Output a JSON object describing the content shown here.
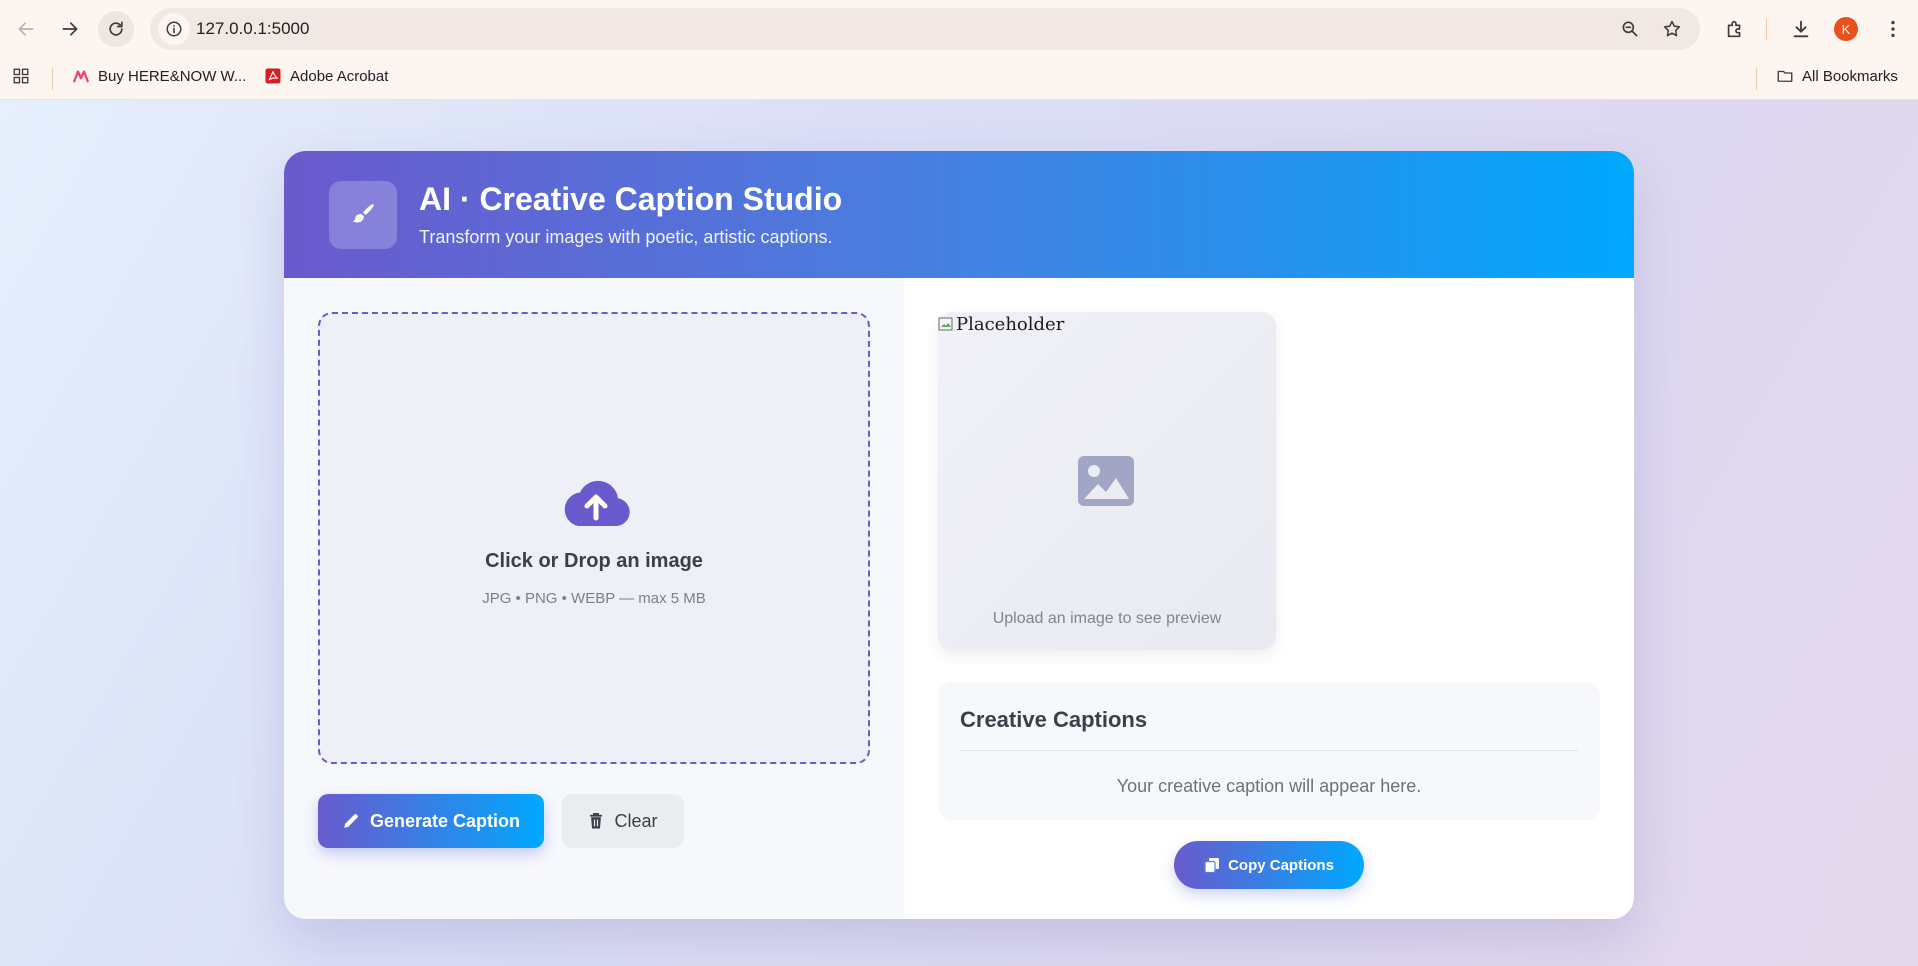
{
  "browser": {
    "url": "127.0.0.1:5000",
    "avatar_letter": "K",
    "bookmarks": [
      {
        "label": "Buy HERE&NOW W...",
        "icon": "myntra-icon"
      },
      {
        "label": "Adobe Acrobat",
        "icon": "acrobat-icon"
      }
    ],
    "all_bookmarks_label": "All Bookmarks"
  },
  "header": {
    "title": "AI · Creative Caption Studio",
    "subtitle": "Transform your images with poetic, artistic captions.",
    "logo_icon": "paintbrush-icon"
  },
  "upload": {
    "title": "Click or Drop an image",
    "hint": "JPG • PNG • WEBP — max 5 MB",
    "icon": "cloud-upload-icon"
  },
  "buttons": {
    "generate": "Generate Caption",
    "clear": "Clear",
    "copy": "Copy Captions"
  },
  "preview": {
    "alt_text": "Placeholder",
    "hint": "Upload an image to see preview",
    "icon": "image-icon"
  },
  "captions": {
    "title": "Creative Captions",
    "placeholder": "Your creative caption will appear here."
  },
  "colors": {
    "accent_start": "#6a5acd",
    "accent_end": "#00a8ff"
  }
}
